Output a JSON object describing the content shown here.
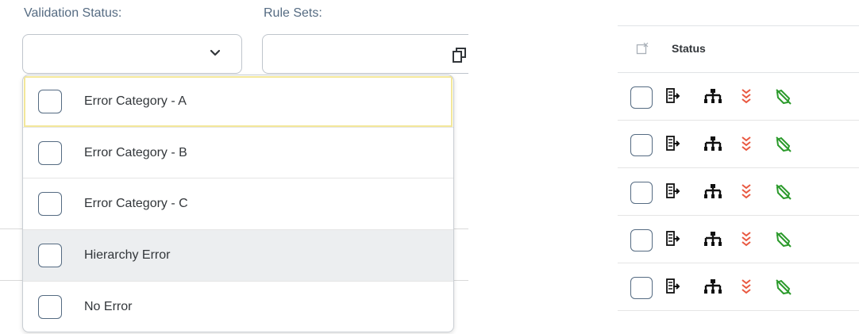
{
  "filters": {
    "validation_status": {
      "label": "Validation Status:",
      "value": ""
    },
    "rule_sets": {
      "label": "Rule Sets:",
      "value": ""
    }
  },
  "dropdown": {
    "options": [
      {
        "label": "Error Category - A",
        "checked": false,
        "state": "focused"
      },
      {
        "label": "Error Category - B",
        "checked": false,
        "state": "normal"
      },
      {
        "label": "Error Category - C",
        "checked": false,
        "state": "normal"
      },
      {
        "label": "Hierarchy Error",
        "checked": false,
        "state": "hover"
      },
      {
        "label": "No Error",
        "checked": false,
        "state": "normal"
      }
    ]
  },
  "table": {
    "header": {
      "status_label": "Status"
    },
    "rows": [
      {
        "icons": [
          "export-icon",
          "hierarchy-icon",
          "priority-low-icon",
          "rule-icon"
        ]
      },
      {
        "icons": [
          "export-icon",
          "hierarchy-icon",
          "priority-low-icon",
          "rule-icon"
        ]
      },
      {
        "icons": [
          "export-icon",
          "hierarchy-icon",
          "priority-low-icon",
          "rule-icon"
        ]
      },
      {
        "icons": [
          "export-icon",
          "hierarchy-icon",
          "priority-low-icon",
          "rule-icon"
        ]
      },
      {
        "icons": [
          "export-icon",
          "hierarchy-icon",
          "priority-low-icon",
          "rule-icon"
        ]
      }
    ]
  },
  "colors": {
    "label": "#556b82",
    "border": "#bfc5cc",
    "focus_outline": "#f3e79a",
    "hover_bg": "#eceef0",
    "priority_red": "#e9573f",
    "rule_green": "#2b9a2b"
  }
}
